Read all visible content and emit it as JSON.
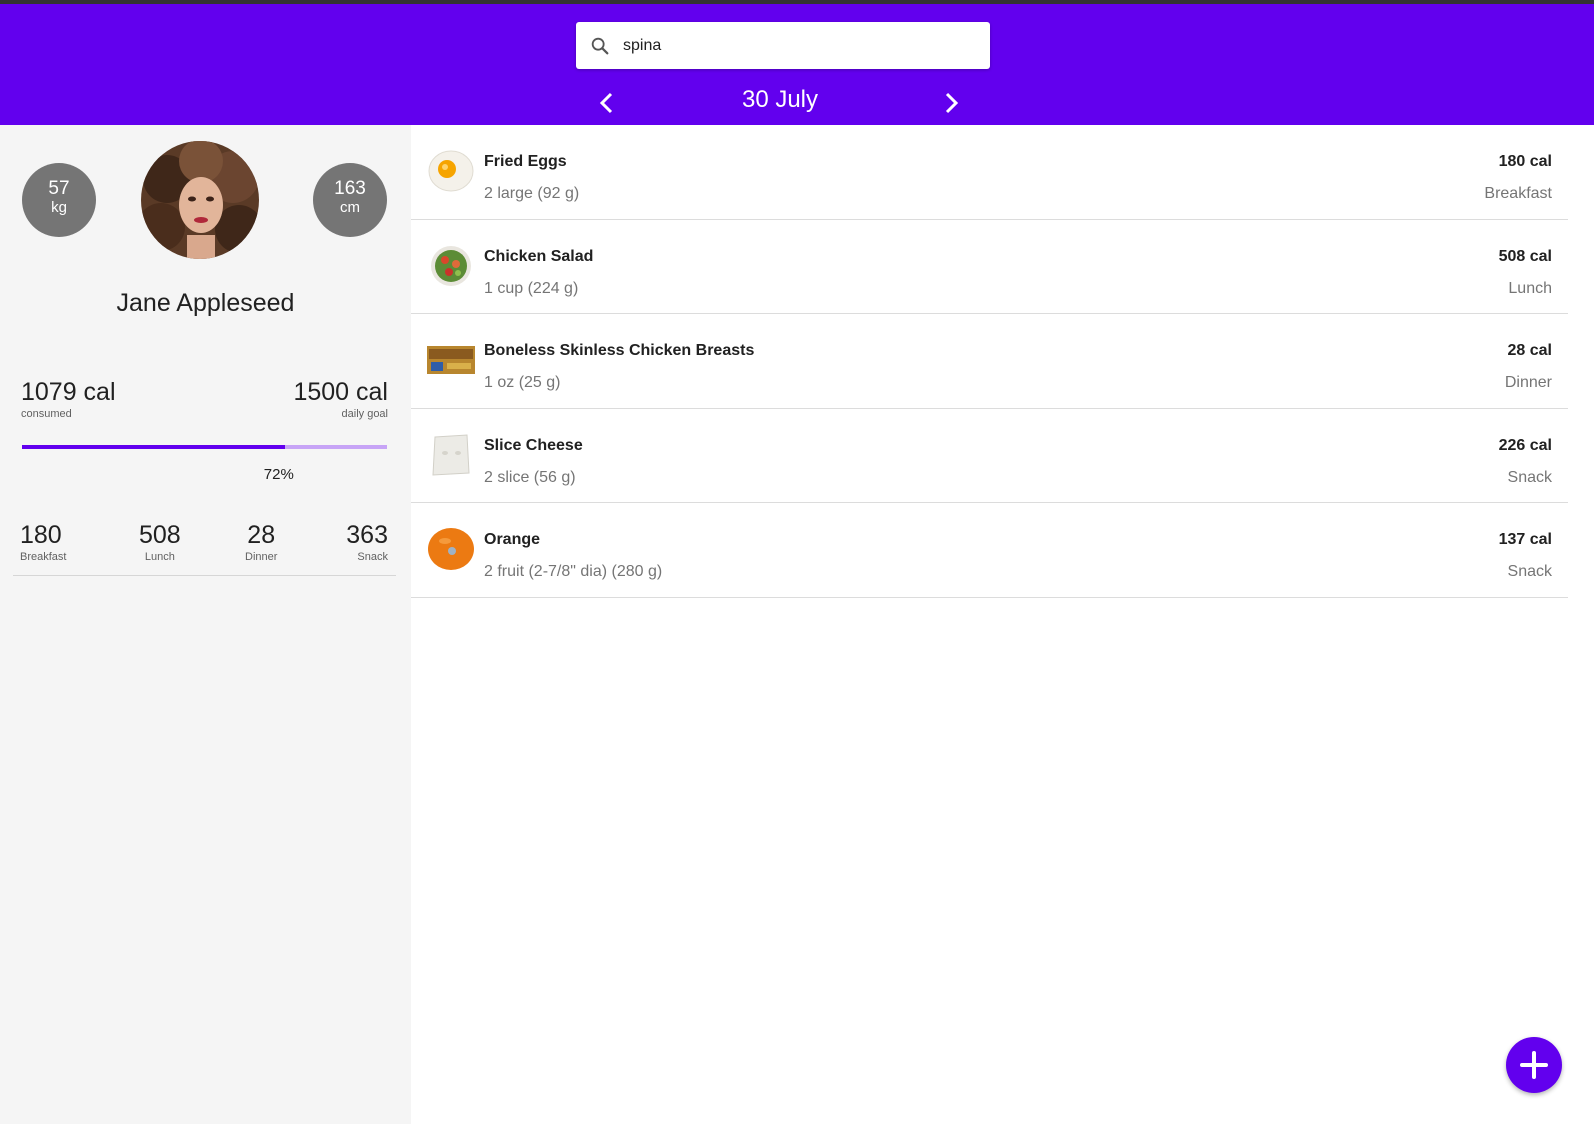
{
  "search": {
    "value": "spina",
    "placeholder": ""
  },
  "date": {
    "label": "30 July"
  },
  "profile": {
    "weight_value": "57",
    "weight_unit": "kg",
    "height_value": "163",
    "height_unit": "cm",
    "name": "Jane Appleseed"
  },
  "calories": {
    "consumed": "1079 cal",
    "consumed_label": "consumed",
    "goal": "1500 cal",
    "goal_label": "daily goal",
    "progress_fraction": 0.72,
    "percent_text": "72%"
  },
  "meal_totals": [
    {
      "value": "180",
      "label": "Breakfast"
    },
    {
      "value": "508",
      "label": "Lunch"
    },
    {
      "value": "28",
      "label": "Dinner"
    },
    {
      "value": "363",
      "label": "Snack"
    }
  ],
  "entries": [
    {
      "name": "Fried Eggs",
      "serving": "2 large (92 g)",
      "calories": "180 cal",
      "meal": "Breakfast",
      "icon": "fried-egg-image"
    },
    {
      "name": "Chicken Salad",
      "serving": "1 cup (224 g)",
      "calories": "508 cal",
      "meal": "Lunch",
      "icon": "chicken-salad-image"
    },
    {
      "name": "Boneless Skinless Chicken Breasts",
      "serving": "1 oz (25 g)",
      "calories": "28 cal",
      "meal": "Dinner",
      "icon": "chicken-package-image"
    },
    {
      "name": "Slice Cheese",
      "serving": "2 slice (56 g)",
      "calories": "226 cal",
      "meal": "Snack",
      "icon": "cheese-slice-image"
    },
    {
      "name": "Orange",
      "serving": "2 fruit (2-7/8\" dia) (280 g)",
      "calories": "137 cal",
      "meal": "Snack",
      "icon": "orange-image"
    }
  ],
  "colors": {
    "primary": "#6200ee",
    "progress_track": "#c7a4f6",
    "stat_circle": "#757575",
    "sidebar_bg": "#f5f5f5"
  }
}
